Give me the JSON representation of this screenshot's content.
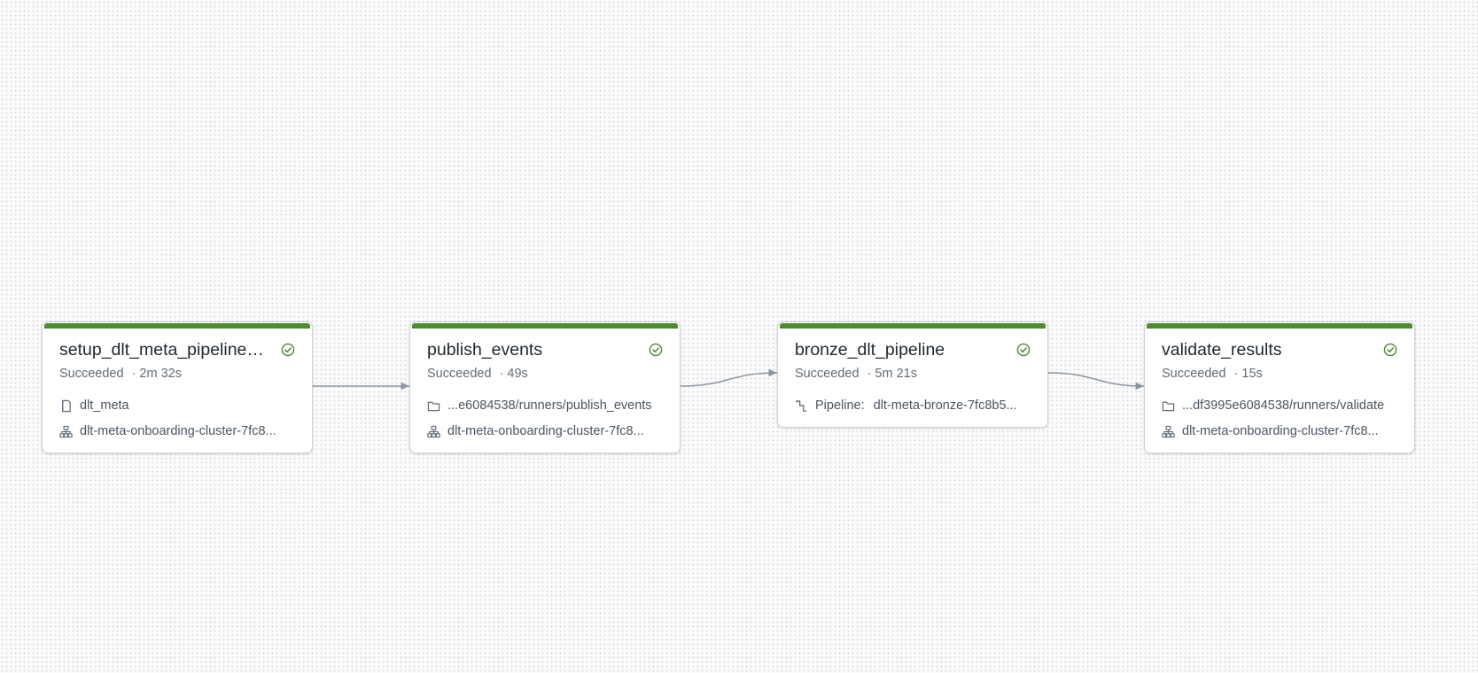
{
  "colors": {
    "success": "#4e8b2e",
    "edge": "#8c96a1"
  },
  "nodes": [
    {
      "title": "setup_dlt_meta_pipeline_...",
      "status": "Succeeded",
      "duration": "2m 32s",
      "rows": [
        {
          "icon": "notebook-icon",
          "label": "",
          "text": "dlt_meta"
        },
        {
          "icon": "cluster-icon",
          "label": "",
          "text": "dlt-meta-onboarding-cluster-7fc8..."
        }
      ]
    },
    {
      "title": "publish_events",
      "status": "Succeeded",
      "duration": "49s",
      "rows": [
        {
          "icon": "folder-icon",
          "label": "",
          "text": "...e6084538/runners/publish_events"
        },
        {
          "icon": "cluster-icon",
          "label": "",
          "text": "dlt-meta-onboarding-cluster-7fc8..."
        }
      ]
    },
    {
      "title": "bronze_dlt_pipeline",
      "status": "Succeeded",
      "duration": "5m 21s",
      "rows": [
        {
          "icon": "pipeline-icon",
          "label": "Pipeline:",
          "text": "dlt-meta-bronze-7fc8b5..."
        }
      ]
    },
    {
      "title": "validate_results",
      "status": "Succeeded",
      "duration": "15s",
      "rows": [
        {
          "icon": "folder-icon",
          "label": "",
          "text": "...df3995e6084538/runners/validate"
        },
        {
          "icon": "cluster-icon",
          "label": "",
          "text": "dlt-meta-onboarding-cluster-7fc8..."
        }
      ]
    }
  ]
}
